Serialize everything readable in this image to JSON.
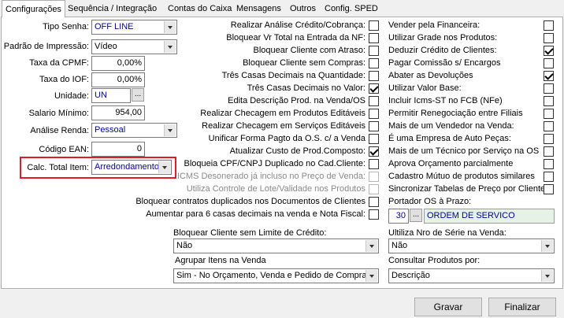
{
  "tabs": [
    "Configurações",
    "Sequência / Integração",
    "Contas do Caixa",
    "Mensagens",
    "Outros",
    "Config. SPED"
  ],
  "left": {
    "tipo_senha": {
      "label": "Tipo Senha:",
      "value": "OFF LINE"
    },
    "padrao_impressao": {
      "label": "Padrão de Impressão:",
      "value": "Vídeo"
    },
    "taxa_cpmf": {
      "label": "Taxa da CPMF:",
      "value": "0,00%"
    },
    "taxa_iof": {
      "label": "Taxa do IOF:",
      "value": "0,00%"
    },
    "unidade": {
      "label": "Unidade:",
      "value": "UN",
      "btn": "..."
    },
    "salario_minimo": {
      "label": "Salario Mínimo:",
      "value": "954,00"
    },
    "analise_renda": {
      "label": "Análise Renda:",
      "value": "Pessoal"
    },
    "codigo_ean": {
      "label": "Código EAN:",
      "value": "0"
    },
    "calc_total_item": {
      "label": "Calc. Total Item:",
      "value": "Arredondamento"
    }
  },
  "middle_checks": [
    {
      "label": "Realizar Análise Crédito/Cobrança:",
      "checked": false,
      "disabled": false
    },
    {
      "label": "Bloquear Vr Total na Entrada da NF:",
      "checked": false,
      "disabled": false
    },
    {
      "label": "Bloquear Cliente com Atraso:",
      "checked": false,
      "disabled": false
    },
    {
      "label": "Bloquear Cliente sem Compras:",
      "checked": false,
      "disabled": false
    },
    {
      "label": "Três Casas Decimais na Quantidade:",
      "checked": false,
      "disabled": false
    },
    {
      "label": "Três Casas Decimais no Valor:",
      "checked": true,
      "disabled": false
    },
    {
      "label": "Edita Descrição Prod. na Venda/OS",
      "checked": false,
      "disabled": false
    },
    {
      "label": "Realizar Checagem em Produtos Editáveis",
      "checked": false,
      "disabled": false
    },
    {
      "label": "Realizar Checagem em Serviços Editáveis",
      "checked": false,
      "disabled": false
    },
    {
      "label": "Unificar Forma Pagto da O.S. c/ a Venda",
      "checked": false,
      "disabled": false
    },
    {
      "label": "Atualizar Custo de Prod.Composto:",
      "checked": true,
      "disabled": false
    },
    {
      "label": "Bloqueia CPF/CNPJ Duplicado no Cad.Cliente:",
      "checked": false,
      "disabled": false
    },
    {
      "label": "ICMS Desonerado já incluso no Preço de Venda:",
      "checked": false,
      "disabled": true
    },
    {
      "label": "Utiliza Controle de Lote/Validade nos Produtos",
      "checked": false,
      "disabled": true
    },
    {
      "label": "Bloquear contratos duplicados nos Documentos de Clientes",
      "checked": false,
      "disabled": false
    },
    {
      "label": "Aumentar para 6 casas decimais na venda e Nota Fiscal:",
      "checked": false,
      "disabled": false
    }
  ],
  "right_checks": [
    {
      "label": "Vender pela Financeira:",
      "checked": false
    },
    {
      "label": "Utilizar Grade nos Produtos:",
      "checked": false
    },
    {
      "label": "Deduzir Crédito de Clientes:",
      "checked": true
    },
    {
      "label": "Pagar Comissão s/ Encargos",
      "checked": false
    },
    {
      "label": "Abater as Devoluções",
      "checked": true
    },
    {
      "label": "Utilizar Valor Base:",
      "checked": false
    },
    {
      "label": "Incluir Icms-ST no FCB (NFe)",
      "checked": false
    },
    {
      "label": "Permitir Renegociação entre Filiais",
      "checked": false
    },
    {
      "label": "Mais de um Vendedor na Venda:",
      "checked": false
    },
    {
      "label": "É uma Empresa de Auto Peças:",
      "checked": false
    },
    {
      "label": "Mais de um Técnico por Serviço na OS",
      "checked": false
    },
    {
      "label": "Aprova Orçamento parcialmente",
      "checked": false
    },
    {
      "label": "Cadastro Mútuo de produtos similares",
      "checked": false
    },
    {
      "label": "Sincronizar Tabelas de Preço por Cliente",
      "checked": false
    }
  ],
  "portador": {
    "label": "Portador OS à Prazo:",
    "code": "30",
    "btn": "...",
    "name": "ORDEM DE SERVICO"
  },
  "bottom": {
    "bloquear_limite": {
      "label": "Bloquear Cliente sem Limite de Crédito:",
      "value": "Não"
    },
    "agrupar_itens": {
      "label": "Agrupar Itens na Venda",
      "value": "Sim - No Orçamento, Venda e Pedido de Compra"
    },
    "nro_serie": {
      "label": "Ultiliza Nro de Série na Venda:",
      "value": "Não"
    },
    "consultar_produtos": {
      "label": "Consultar Produtos por:",
      "value": "Descrição"
    }
  },
  "buttons": {
    "gravar": "Gravar",
    "finalizar": "Finalizar"
  },
  "colors": {
    "highlight": "#e31b23",
    "accent_text": "#0000b0",
    "panel_bg": "#ffffff"
  }
}
